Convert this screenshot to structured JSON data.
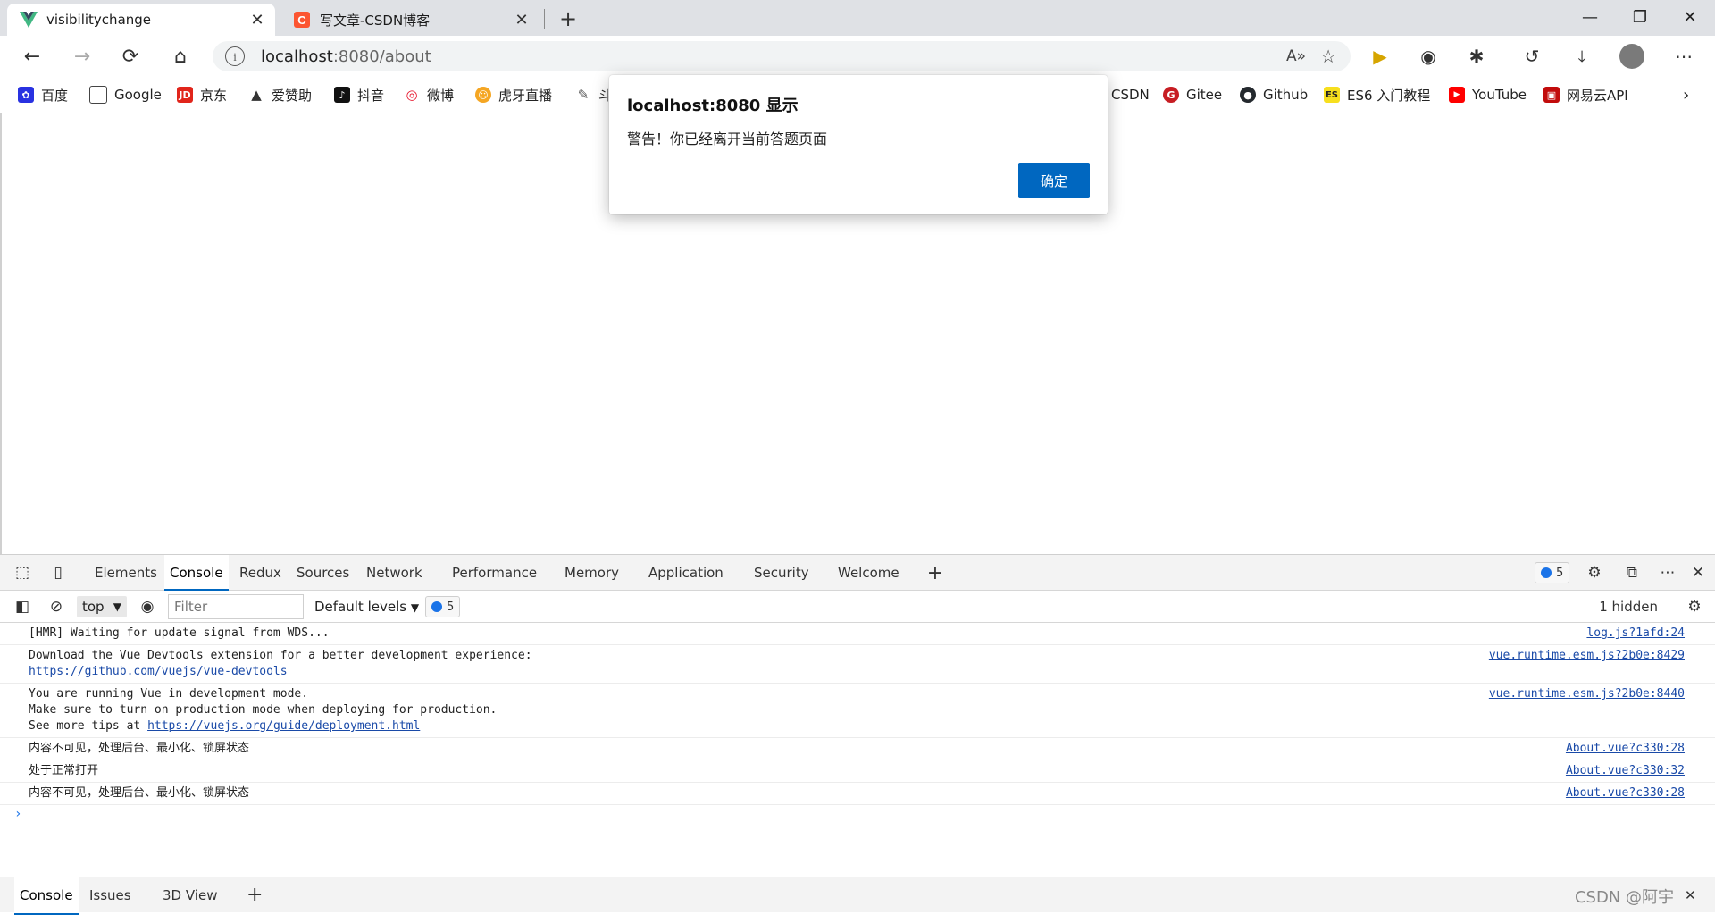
{
  "tabs": [
    {
      "title": "visibilitychange",
      "active": true
    },
    {
      "title": "写文章-CSDN博客",
      "active": false
    }
  ],
  "address": {
    "host": "localhost",
    "rest": ":8080/about"
  },
  "bookmarks": [
    "百度",
    "Google",
    "京东",
    "爱赞助",
    "抖音",
    "微博",
    "虎牙直播",
    "斗",
    "CSDN",
    "Gitee",
    "Github",
    "ES6 入门教程",
    "YouTube",
    "网易云API"
  ],
  "alert": {
    "title": "localhost:8080 显示",
    "message": "警告！你已经离开当前答题页面",
    "ok_label": "确定"
  },
  "devtools": {
    "tabs": [
      "Elements",
      "Console",
      "Redux",
      "Sources",
      "Network",
      "Performance",
      "Memory",
      "Application",
      "Security",
      "Welcome"
    ],
    "active_tab": "Console",
    "issues_count": "5",
    "context": "top",
    "filter_placeholder": "Filter",
    "levels": "Default levels",
    "levels_badge": "5",
    "hidden": "1 hidden",
    "messages": [
      {
        "lines": [
          "[HMR] Waiting for update signal from WDS..."
        ],
        "source": "log.js?1afd:24"
      },
      {
        "lines": [
          "Download the Vue Devtools extension for a better development experience:"
        ],
        "link": "https://github.com/vuejs/vue-devtools",
        "source": "vue.runtime.esm.js?2b0e:8429"
      },
      {
        "lines": [
          "You are running Vue in development mode.",
          "Make sure to turn on production mode when deploying for production."
        ],
        "prefix": "See more tips at ",
        "link": "https://vuejs.org/guide/deployment.html",
        "source": "vue.runtime.esm.js?2b0e:8440"
      },
      {
        "lines": [
          "内容不可见，处理后台、最小化、锁屏状态"
        ],
        "source": "About.vue?c330:28"
      },
      {
        "lines": [
          "处于正常打开"
        ],
        "source": "About.vue?c330:32"
      },
      {
        "lines": [
          "内容不可见，处理后台、最小化、锁屏状态"
        ],
        "source": "About.vue?c330:28"
      }
    ],
    "drawer_tabs": [
      "Console",
      "Issues",
      "3D View"
    ],
    "watermark": "CSDN @阿宇"
  },
  "colors": {
    "accent": "#0067c0",
    "vue_green": "#41b883",
    "csdn_red": "#fc5531"
  }
}
